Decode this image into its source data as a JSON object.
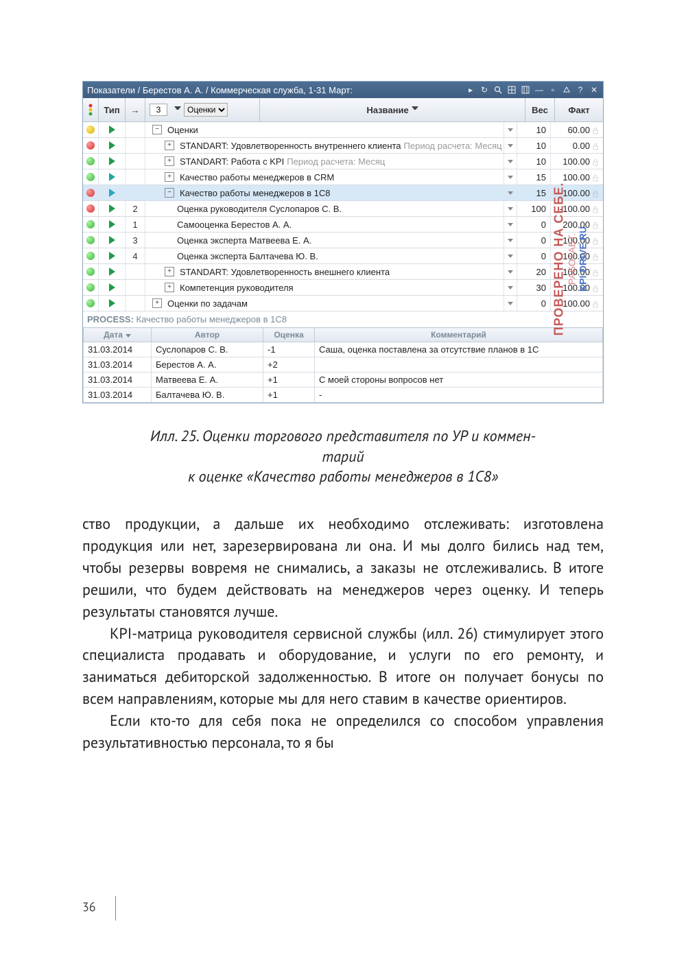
{
  "window": {
    "title": "Показатели / Берестов А. А. / Коммерческая служба, 1-31 Март:"
  },
  "toolbar_icons": [
    "refresh",
    "search",
    "grid",
    "columns",
    "minimize",
    "restore",
    "cascade",
    "help",
    "close"
  ],
  "grid": {
    "headers": {
      "type": "Тип",
      "arrow": "→",
      "level_value": "3",
      "filter_value": "Оценки",
      "name": "Название",
      "weight": "Вес",
      "fact": "Факт"
    },
    "rows": [
      {
        "dot": "yellow",
        "play": "green",
        "num": "",
        "indent": 0,
        "exp": "-",
        "label": "Оценки",
        "sub": "",
        "menu": true,
        "wt": "10",
        "fact": "60.00"
      },
      {
        "dot": "red",
        "play": "green",
        "num": "",
        "indent": 1,
        "exp": "+",
        "label": "STANDART: Удовлетворенность внутреннего клиента",
        "sub": "  Период расчета: Месяц",
        "menu": true,
        "wt": "10",
        "fact": "0.00"
      },
      {
        "dot": "green",
        "play": "green",
        "num": "",
        "indent": 1,
        "exp": "+",
        "label": "STANDART: Работа с KPI",
        "sub": "  Период расчета: Месяц",
        "menu": true,
        "wt": "10",
        "fact": "100.00"
      },
      {
        "dot": "green",
        "play": "teal",
        "num": "",
        "indent": 1,
        "exp": "+",
        "label": "Качество работы менеджеров в CRM",
        "sub": "",
        "menu": true,
        "wt": "15",
        "fact": "100.00"
      },
      {
        "dot": "red",
        "play": "dteal",
        "num": "",
        "indent": 1,
        "exp": "-",
        "label": "Качество работы менеджеров в 1С8",
        "sub": "",
        "menu": true,
        "wt": "15",
        "fact": "-100.00",
        "sel": true
      },
      {
        "dot": "red",
        "play": "green",
        "num": "2",
        "indent": 2,
        "exp": "",
        "label": "Оценка руководителя Суслопаров С. В.",
        "sub": "",
        "menu": true,
        "wt": "100",
        "fact": "-100.00"
      },
      {
        "dot": "green",
        "play": "green",
        "num": "1",
        "indent": 2,
        "exp": "",
        "label": "Самооценка Берестов А. А.",
        "sub": "",
        "menu": true,
        "wt": "0",
        "fact": "200.00"
      },
      {
        "dot": "green",
        "play": "green",
        "num": "3",
        "indent": 2,
        "exp": "",
        "label": "Оценка эксперта Матвеева Е. А.",
        "sub": "",
        "menu": true,
        "wt": "0",
        "fact": "100.00"
      },
      {
        "dot": "green",
        "play": "green",
        "num": "4",
        "indent": 2,
        "exp": "",
        "label": "Оценка эксперта Балтачева Ю. В.",
        "sub": "",
        "menu": true,
        "wt": "0",
        "fact": "100.00"
      },
      {
        "dot": "green",
        "play": "green",
        "num": "",
        "indent": 1,
        "exp": "+",
        "label": "STANDART: Удовлетворенность внешнего клиента",
        "sub": "",
        "menu": true,
        "wt": "20",
        "fact": "100.00"
      },
      {
        "dot": "green",
        "play": "green",
        "num": "",
        "indent": 1,
        "exp": "+",
        "label": "Компетенция руководителя",
        "sub": "",
        "menu": true,
        "wt": "30",
        "fact": "100.00"
      },
      {
        "dot": "green",
        "play": "green",
        "num": "",
        "indent": 0,
        "exp": "+",
        "label": "Оценки по задачам",
        "sub": "",
        "menu": true,
        "wt": "0",
        "fact": "100.00"
      }
    ]
  },
  "watermark": {
    "l1": "ПРОВЕРЕНО НА СЕБЕ.",
    "l2": "РАБОТАЕТ.",
    "l3": "KPI-DRIVE.RU"
  },
  "process": {
    "label": "PROCESS:",
    "text": "Качество работы менеджеров в 1С8"
  },
  "details": {
    "headers": {
      "date": "Дата",
      "author": "Автор",
      "score": "Оценка",
      "comment": "Комментарий"
    },
    "rows": [
      {
        "date": "31.03.2014",
        "author": "Суслопаров С. В.",
        "score": "-1",
        "comment": "Саша, оценка поставлена за отсутствие планов в 1С"
      },
      {
        "date": "31.03.2014",
        "author": "Берестов А. А.",
        "score": "+2",
        "comment": ""
      },
      {
        "date": "31.03.2014",
        "author": "Матвеева Е. А.",
        "score": "+1",
        "comment": "С моей стороны вопросов нет"
      },
      {
        "date": "31.03.2014",
        "author": "Балтачева Ю. В.",
        "score": "+1",
        "comment": "-"
      }
    ]
  },
  "caption": {
    "line1": "Илл. 25. Оценки торгового представителя по УР и коммен-",
    "line2": "тарий",
    "line3": "к оценке «Качество работы менеджеров в 1С8»"
  },
  "body": {
    "p1": "ство продукции, а дальше их необходимо отслеживать: изготовлена продукция или нет, зарезервирована ли она. И мы долго бились над тем, чтобы резервы вовремя не снимались, а заказы не отслеживались. В итоге реши­ли, что будем действовать на менеджеров через оценку. И теперь результаты становятся лучше.",
    "p2": "KPI-матрица руководителя сервисной службы (илл. 26) стимулирует этого специалиста продавать и оборудование, и услуги по его ремонту, и заниматься дебиторской задол­женностью. В итоге он получает бонусы по всем направле­ниям, которые мы для него ставим в качестве ориентиров.",
    "p3": "Если кто-то для себя пока не определился со спосо­бом управления результативностью персонала, то я бы"
  },
  "page_number": "36"
}
